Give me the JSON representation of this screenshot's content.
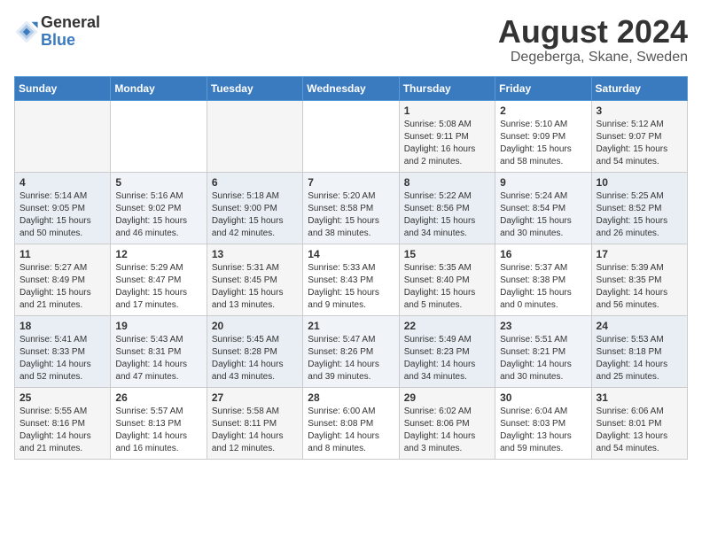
{
  "logo": {
    "general": "General",
    "blue": "Blue"
  },
  "title": "August 2024",
  "subtitle": "Degeberga, Skane, Sweden",
  "weekdays": [
    "Sunday",
    "Monday",
    "Tuesday",
    "Wednesday",
    "Thursday",
    "Friday",
    "Saturday"
  ],
  "weeks": [
    [
      {
        "day": "",
        "lines": []
      },
      {
        "day": "",
        "lines": []
      },
      {
        "day": "",
        "lines": []
      },
      {
        "day": "",
        "lines": []
      },
      {
        "day": "1",
        "lines": [
          "Sunrise: 5:08 AM",
          "Sunset: 9:11 PM",
          "Daylight: 16 hours",
          "and 2 minutes."
        ]
      },
      {
        "day": "2",
        "lines": [
          "Sunrise: 5:10 AM",
          "Sunset: 9:09 PM",
          "Daylight: 15 hours",
          "and 58 minutes."
        ]
      },
      {
        "day": "3",
        "lines": [
          "Sunrise: 5:12 AM",
          "Sunset: 9:07 PM",
          "Daylight: 15 hours",
          "and 54 minutes."
        ]
      }
    ],
    [
      {
        "day": "4",
        "lines": [
          "Sunrise: 5:14 AM",
          "Sunset: 9:05 PM",
          "Daylight: 15 hours",
          "and 50 minutes."
        ]
      },
      {
        "day": "5",
        "lines": [
          "Sunrise: 5:16 AM",
          "Sunset: 9:02 PM",
          "Daylight: 15 hours",
          "and 46 minutes."
        ]
      },
      {
        "day": "6",
        "lines": [
          "Sunrise: 5:18 AM",
          "Sunset: 9:00 PM",
          "Daylight: 15 hours",
          "and 42 minutes."
        ]
      },
      {
        "day": "7",
        "lines": [
          "Sunrise: 5:20 AM",
          "Sunset: 8:58 PM",
          "Daylight: 15 hours",
          "and 38 minutes."
        ]
      },
      {
        "day": "8",
        "lines": [
          "Sunrise: 5:22 AM",
          "Sunset: 8:56 PM",
          "Daylight: 15 hours",
          "and 34 minutes."
        ]
      },
      {
        "day": "9",
        "lines": [
          "Sunrise: 5:24 AM",
          "Sunset: 8:54 PM",
          "Daylight: 15 hours",
          "and 30 minutes."
        ]
      },
      {
        "day": "10",
        "lines": [
          "Sunrise: 5:25 AM",
          "Sunset: 8:52 PM",
          "Daylight: 15 hours",
          "and 26 minutes."
        ]
      }
    ],
    [
      {
        "day": "11",
        "lines": [
          "Sunrise: 5:27 AM",
          "Sunset: 8:49 PM",
          "Daylight: 15 hours",
          "and 21 minutes."
        ]
      },
      {
        "day": "12",
        "lines": [
          "Sunrise: 5:29 AM",
          "Sunset: 8:47 PM",
          "Daylight: 15 hours",
          "and 17 minutes."
        ]
      },
      {
        "day": "13",
        "lines": [
          "Sunrise: 5:31 AM",
          "Sunset: 8:45 PM",
          "Daylight: 15 hours",
          "and 13 minutes."
        ]
      },
      {
        "day": "14",
        "lines": [
          "Sunrise: 5:33 AM",
          "Sunset: 8:43 PM",
          "Daylight: 15 hours",
          "and 9 minutes."
        ]
      },
      {
        "day": "15",
        "lines": [
          "Sunrise: 5:35 AM",
          "Sunset: 8:40 PM",
          "Daylight: 15 hours",
          "and 5 minutes."
        ]
      },
      {
        "day": "16",
        "lines": [
          "Sunrise: 5:37 AM",
          "Sunset: 8:38 PM",
          "Daylight: 15 hours",
          "and 0 minutes."
        ]
      },
      {
        "day": "17",
        "lines": [
          "Sunrise: 5:39 AM",
          "Sunset: 8:35 PM",
          "Daylight: 14 hours",
          "and 56 minutes."
        ]
      }
    ],
    [
      {
        "day": "18",
        "lines": [
          "Sunrise: 5:41 AM",
          "Sunset: 8:33 PM",
          "Daylight: 14 hours",
          "and 52 minutes."
        ]
      },
      {
        "day": "19",
        "lines": [
          "Sunrise: 5:43 AM",
          "Sunset: 8:31 PM",
          "Daylight: 14 hours",
          "and 47 minutes."
        ]
      },
      {
        "day": "20",
        "lines": [
          "Sunrise: 5:45 AM",
          "Sunset: 8:28 PM",
          "Daylight: 14 hours",
          "and 43 minutes."
        ]
      },
      {
        "day": "21",
        "lines": [
          "Sunrise: 5:47 AM",
          "Sunset: 8:26 PM",
          "Daylight: 14 hours",
          "and 39 minutes."
        ]
      },
      {
        "day": "22",
        "lines": [
          "Sunrise: 5:49 AM",
          "Sunset: 8:23 PM",
          "Daylight: 14 hours",
          "and 34 minutes."
        ]
      },
      {
        "day": "23",
        "lines": [
          "Sunrise: 5:51 AM",
          "Sunset: 8:21 PM",
          "Daylight: 14 hours",
          "and 30 minutes."
        ]
      },
      {
        "day": "24",
        "lines": [
          "Sunrise: 5:53 AM",
          "Sunset: 8:18 PM",
          "Daylight: 14 hours",
          "and 25 minutes."
        ]
      }
    ],
    [
      {
        "day": "25",
        "lines": [
          "Sunrise: 5:55 AM",
          "Sunset: 8:16 PM",
          "Daylight: 14 hours",
          "and 21 minutes."
        ]
      },
      {
        "day": "26",
        "lines": [
          "Sunrise: 5:57 AM",
          "Sunset: 8:13 PM",
          "Daylight: 14 hours",
          "and 16 minutes."
        ]
      },
      {
        "day": "27",
        "lines": [
          "Sunrise: 5:58 AM",
          "Sunset: 8:11 PM",
          "Daylight: 14 hours",
          "and 12 minutes."
        ]
      },
      {
        "day": "28",
        "lines": [
          "Sunrise: 6:00 AM",
          "Sunset: 8:08 PM",
          "Daylight: 14 hours",
          "and 8 minutes."
        ]
      },
      {
        "day": "29",
        "lines": [
          "Sunrise: 6:02 AM",
          "Sunset: 8:06 PM",
          "Daylight: 14 hours",
          "and 3 minutes."
        ]
      },
      {
        "day": "30",
        "lines": [
          "Sunrise: 6:04 AM",
          "Sunset: 8:03 PM",
          "Daylight: 13 hours",
          "and 59 minutes."
        ]
      },
      {
        "day": "31",
        "lines": [
          "Sunrise: 6:06 AM",
          "Sunset: 8:01 PM",
          "Daylight: 13 hours",
          "and 54 minutes."
        ]
      }
    ]
  ]
}
